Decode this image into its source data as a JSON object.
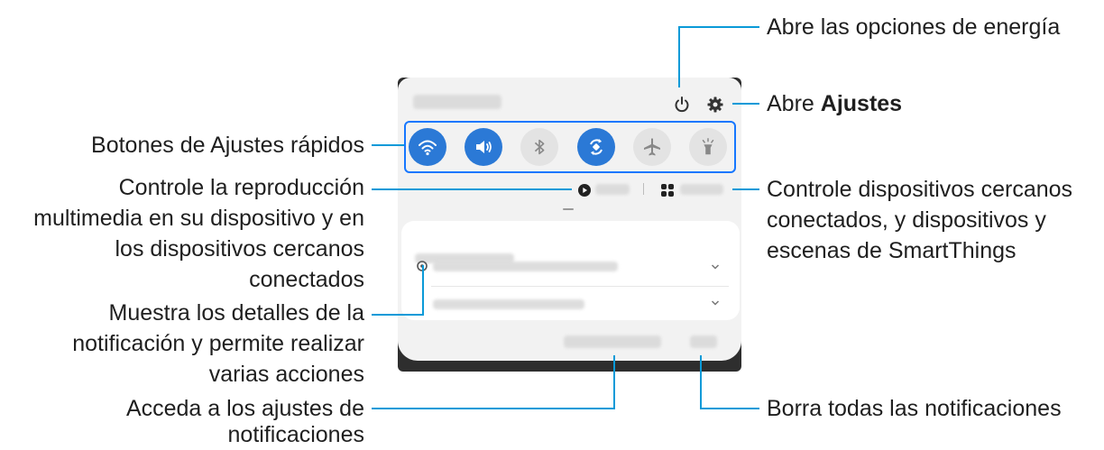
{
  "labels": {
    "power_options": "Abre las opciones de energía",
    "settings_prefix": "Abre ",
    "settings_bold": "Ajustes",
    "quick_buttons": "Botones de Ajustes rápidos",
    "media_line1": "Controle la reproducción",
    "media_line2": "multimedia en su dispositivo y en",
    "media_line3": "los dispositivos cercanos",
    "media_line4": "conectados",
    "devices_line1": "Controle dispositivos cercanos",
    "devices_line2": "conectados, y dispositivos y",
    "devices_line3": "escenas de SmartThings",
    "details_line1": "Muestra los detalles de la",
    "details_line2": "notificación y permite realizar",
    "details_line3": "varias acciones",
    "notif_settings_line1": "Acceda a los ajustes de",
    "notif_settings_line2": "notificaciones",
    "clear_all": "Borra todas las notificaciones"
  },
  "quick_tiles": [
    {
      "icon": "wifi-icon",
      "state": "on"
    },
    {
      "icon": "sound-icon",
      "state": "on"
    },
    {
      "icon": "bluetooth-icon",
      "state": "off"
    },
    {
      "icon": "auto-rotate-icon",
      "state": "on"
    },
    {
      "icon": "airplane-icon",
      "state": "off"
    },
    {
      "icon": "flashlight-icon",
      "state": "off"
    }
  ],
  "colors": {
    "accent_line": "#0a9ad8",
    "tile_on": "#2b79d6",
    "highlight_border": "#1677ff"
  }
}
